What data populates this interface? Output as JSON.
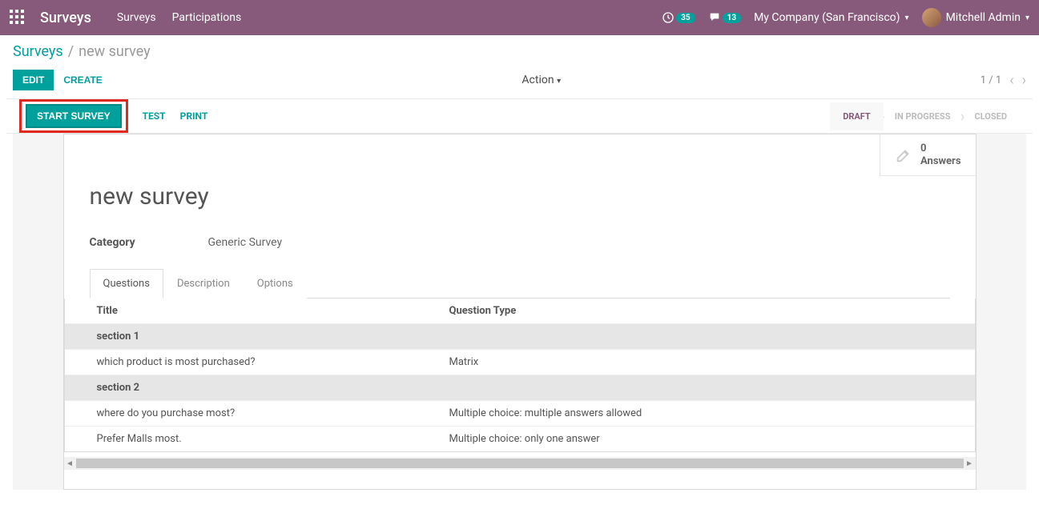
{
  "navbar": {
    "brand": "Surveys",
    "links": [
      "Surveys",
      "Participations"
    ],
    "activity_count": "35",
    "messages_count": "13",
    "company": "My Company (San Francisco)",
    "user": "Mitchell Admin"
  },
  "breadcrumb": {
    "root": "Surveys",
    "current": "new survey"
  },
  "buttons": {
    "edit": "EDIT",
    "create": "CREATE",
    "action": "Action",
    "start_survey": "START SURVEY",
    "test": "TEST",
    "print": "PRINT"
  },
  "pager": "1 / 1",
  "stages": {
    "draft": "DRAFT",
    "in_progress": "IN PROGRESS",
    "closed": "CLOSED"
  },
  "answers": {
    "count": "0",
    "label": "Answers"
  },
  "record": {
    "title": "new survey",
    "category_label": "Category",
    "category_value": "Generic Survey"
  },
  "tabs": {
    "questions": "Questions",
    "description": "Description",
    "options": "Options"
  },
  "table": {
    "col_title": "Title",
    "col_type": "Question Type",
    "rows": [
      {
        "section": true,
        "title": "section 1",
        "type": ""
      },
      {
        "section": false,
        "title": "which product is most purchased?",
        "type": "Matrix"
      },
      {
        "section": true,
        "title": "section 2",
        "type": ""
      },
      {
        "section": false,
        "title": "where do you purchase most?",
        "type": "Multiple choice: multiple answers allowed"
      },
      {
        "section": false,
        "title": "Prefer Malls most.",
        "type": "Multiple choice: only one answer"
      }
    ]
  }
}
